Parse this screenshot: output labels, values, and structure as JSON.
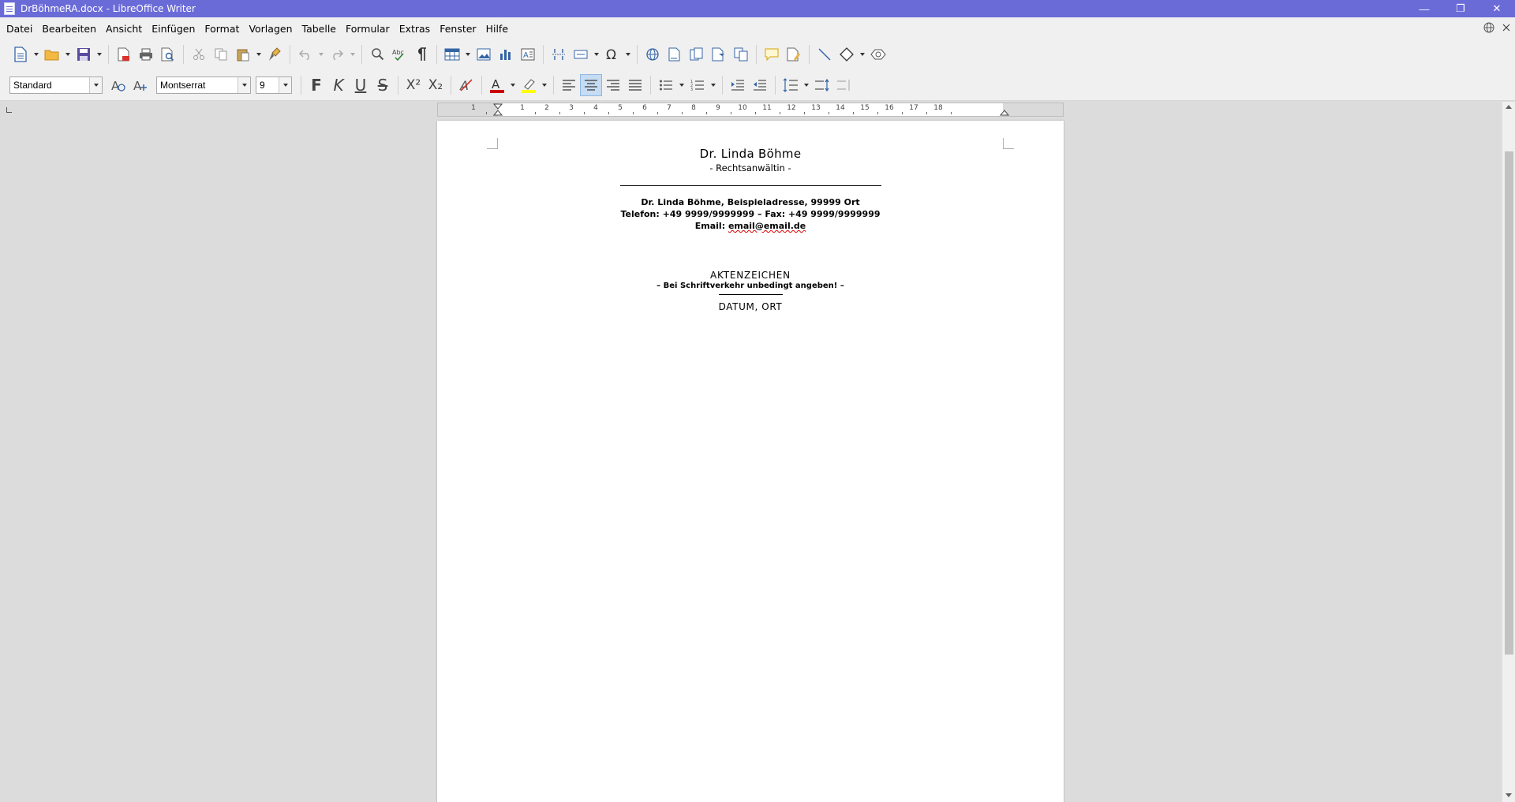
{
  "window": {
    "title": "DrBöhmeRA.docx - LibreOffice Writer",
    "controls": {
      "minimize": "—",
      "maximize": "❐",
      "close": "✕"
    }
  },
  "menu": {
    "items": [
      "Datei",
      "Bearbeiten",
      "Ansicht",
      "Einfügen",
      "Format",
      "Vorlagen",
      "Tabelle",
      "Formular",
      "Extras",
      "Fenster",
      "Hilfe"
    ]
  },
  "formatting": {
    "paragraph_style": "Standard",
    "font_name": "Montserrat",
    "font_size": "9",
    "bold_glyph": "F",
    "italic_glyph": "K",
    "underline_glyph": "U",
    "strike_glyph": "S",
    "superscript_glyph": "X²",
    "subscript_glyph": "X₂",
    "font_color": "#cc0000",
    "highlight_color": "#ffff00",
    "active_alignment": "center"
  },
  "ruler": {
    "labels": [
      "1",
      "1",
      "2",
      "3",
      "4",
      "5",
      "6",
      "7",
      "8",
      "9",
      "10",
      "11",
      "12",
      "13",
      "14",
      "15",
      "16",
      "17",
      "18"
    ]
  },
  "document": {
    "name": "Dr. Linda Böhme",
    "role": "- Rechtsanwältin -",
    "address": "Dr. Linda Böhme, Beispieladresse, 99999 Ort",
    "phone": "Telefon: +49 9999/9999999 – Fax: +49 9999/9999999",
    "email_label": "Email:",
    "email_value": "email@email.de",
    "aktenzeichen": "AKTENZEICHEN",
    "aktenzeichen_note": "– Bei Schriftverkehr unbedingt angeben! –",
    "date_place": "DATUM, ORT"
  },
  "colors": {
    "titlebar": "#6b6bd8",
    "chrome": "#f0f0f0",
    "workspace": "#dcdcdc"
  }
}
